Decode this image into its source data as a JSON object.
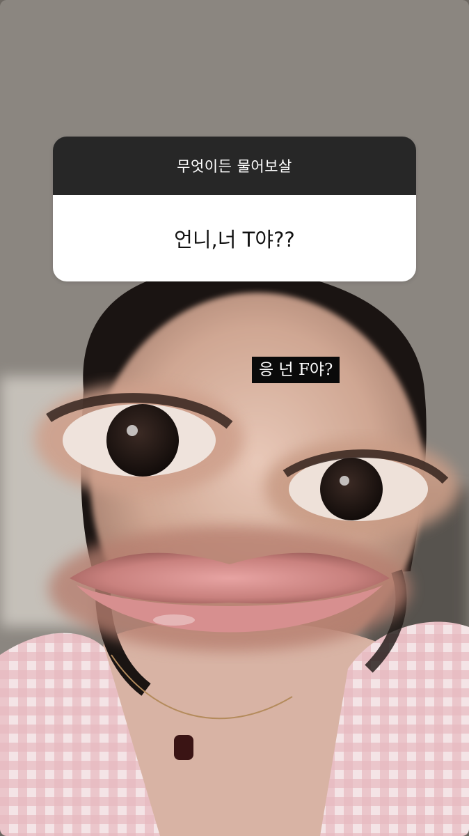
{
  "question_sticker": {
    "prompt": "무엇이든 물어보살",
    "question": "언니,너 T야??"
  },
  "reply_text": "응 넌 F야?"
}
